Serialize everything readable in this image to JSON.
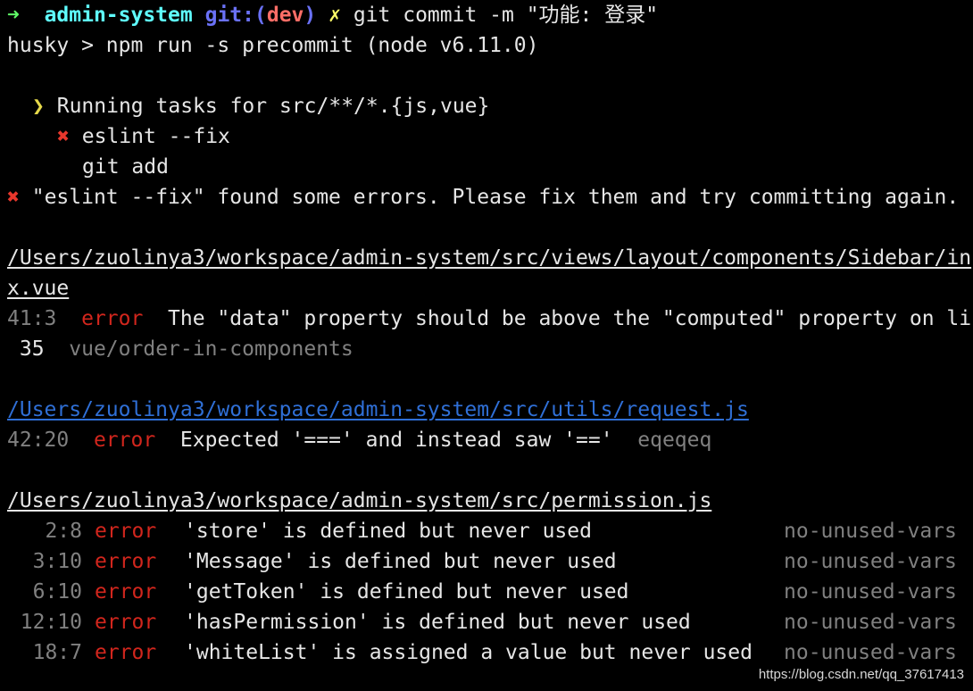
{
  "prompt": {
    "arrow_icon": "➜",
    "directory": "admin-system",
    "git_prefix": "git:(",
    "branch": "dev",
    "git_suffix": ")",
    "dirty_icon": "✗",
    "command": "git commit -m \"功能: 登录\""
  },
  "husky_line": "husky > npm run -s precommit (node v6.11.0)",
  "tasks": {
    "chevron_icon": "❯",
    "header": "Running tasks for src/**/*.{js,vue}",
    "items": [
      {
        "status_icon": "✖",
        "label": "eslint --fix",
        "failed": true
      },
      {
        "status_icon": "",
        "label": "git add",
        "failed": false
      }
    ]
  },
  "summary": {
    "icon": "✖",
    "message": "\"eslint --fix\" found some errors. Please fix them and try committing again."
  },
  "files": [
    {
      "path_line1": "/Users/zuolinya3/workspace/admin-system/src/views/layout/components/Sidebar/in",
      "path_line2": "x.vue",
      "errors": [
        {
          "position": "41:3",
          "severity": "error",
          "message": "The \"data\" property should be above the \"computed\" property on li",
          "continuation_number": "35",
          "rule": "vue/order-in-components"
        }
      ]
    },
    {
      "path": "/Users/zuolinya3/workspace/admin-system/src/utils/request.js",
      "errors": [
        {
          "position": "42:20",
          "severity": "error",
          "message": "Expected '===' and instead saw '=='",
          "rule": "eqeqeq"
        }
      ]
    },
    {
      "path": "/Users/zuolinya3/workspace/admin-system/src/permission.js",
      "errors": [
        {
          "position": "2:8",
          "severity": "error",
          "message": "'store' is defined but never used",
          "rule": "no-unused-vars"
        },
        {
          "position": "3:10",
          "severity": "error",
          "message": "'Message' is defined but never used",
          "rule": "no-unused-vars"
        },
        {
          "position": "6:10",
          "severity": "error",
          "message": "'getToken' is defined but never used",
          "rule": "no-unused-vars"
        },
        {
          "position": "12:10",
          "severity": "error",
          "message": "'hasPermission' is defined but never used",
          "rule": "no-unused-vars"
        },
        {
          "position": "18:7",
          "severity": "error",
          "message": "'whiteList' is assigned a value but never used",
          "rule": "no-unused-vars"
        }
      ]
    }
  ],
  "watermark": "https://blog.csdn.net/qq_37617413"
}
